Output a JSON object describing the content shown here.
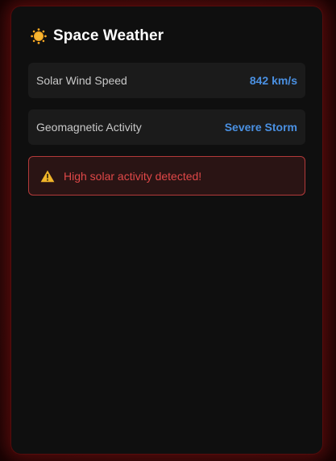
{
  "header": {
    "icon": "sun-icon",
    "title": "Space Weather"
  },
  "metrics": [
    {
      "label": "Solar Wind Speed",
      "value": "842 km/s"
    },
    {
      "label": "Geomagnetic Activity",
      "value": "Severe Storm"
    }
  ],
  "alert": {
    "icon": "warning-icon",
    "text": "High solar activity detected!"
  },
  "colors": {
    "accent": "#4a90e2",
    "alert": "#e04848",
    "alert_border": "#b33a3a",
    "panel": "#0f0f0f",
    "glow": "#a01414"
  }
}
